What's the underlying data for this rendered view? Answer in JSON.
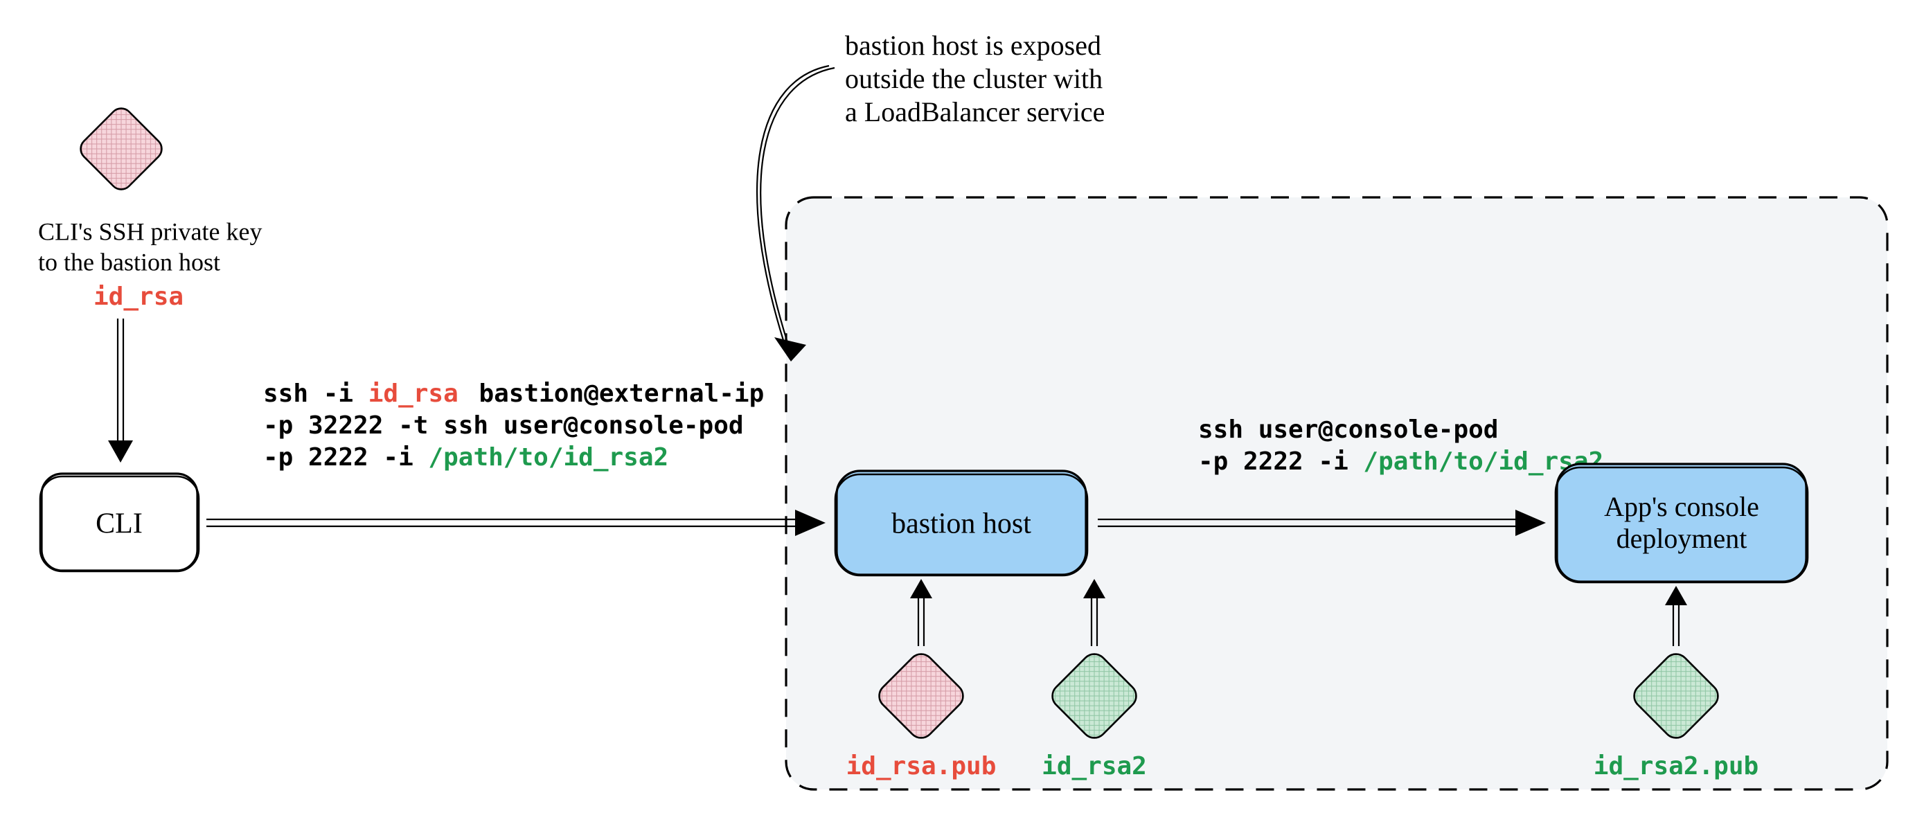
{
  "note": {
    "line1": "bastion host is exposed",
    "line2": "outside the cluster with",
    "line3": "a LoadBalancer service"
  },
  "cliKey": {
    "line1": "CLI's SSH private key",
    "line2": "to the bastion host",
    "file": "id_rsa"
  },
  "nodes": {
    "cli": "CLI",
    "bastion": "bastion host",
    "console1": "App's console",
    "console2": "deployment"
  },
  "cmd1": {
    "prefix1": "ssh -i ",
    "rsa": "id_rsa",
    "suffix1": " bastion@external-ip",
    "line2a": "-p 32222 -t ssh user@console-pod",
    "line3a": "-p 2222 -i ",
    "line3b": "/path/to/id_rsa2"
  },
  "cmd2": {
    "line1": "ssh user@console-pod",
    "line2a": "-p 2222 -i ",
    "line2b": "/path/to/id_rsa2"
  },
  "keys": {
    "rsaPub": "id_rsa.pub",
    "rsa2": "id_rsa2",
    "rsa2Pub": "id_rsa2.pub"
  },
  "colors": {
    "red": "#e74c3c",
    "green": "#1e9a4e",
    "blue": "#9fd1f6",
    "pink": "#f7d6dc",
    "lightGreen": "#cbe9d6",
    "cluster": "#e9edf0"
  }
}
